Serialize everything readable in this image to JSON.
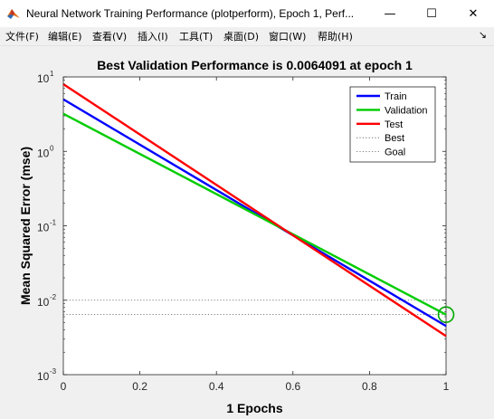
{
  "window": {
    "title": "Neural Network Training Performance (plotperform), Epoch 1, Perf...",
    "app_icon": "matlab-icon",
    "minimize_glyph": "—",
    "maximize_glyph": "☐",
    "close_glyph": "✕"
  },
  "menubar": {
    "items": [
      {
        "label": "文件(F)"
      },
      {
        "label": "编辑(E)"
      },
      {
        "label": "查看(V)"
      },
      {
        "label": "插入(I)"
      },
      {
        "label": "工具(T)"
      },
      {
        "label": "桌面(D)"
      },
      {
        "label": "窗口(W)"
      },
      {
        "label": "帮助(H)"
      }
    ],
    "overflow_glyph": "↘"
  },
  "chart_data": {
    "type": "line",
    "title": "Best Validation Performance is 0.0064091 at epoch 1",
    "xlabel": "1 Epochs",
    "ylabel": "Mean Squared Error  (mse)",
    "xlim": [
      0,
      1
    ],
    "ylim": [
      0.001,
      10
    ],
    "yscale": "log",
    "xticks": [
      "0",
      "0.2",
      "0.4",
      "0.6",
      "0.8",
      "1"
    ],
    "yticks": [
      {
        "base": "10",
        "exp": "1",
        "value": 10
      },
      {
        "base": "10",
        "exp": "0",
        "value": 1
      },
      {
        "base": "10",
        "exp": "-1",
        "value": 0.1
      },
      {
        "base": "10",
        "exp": "-2",
        "value": 0.01
      },
      {
        "base": "10",
        "exp": "-3",
        "value": 0.001
      }
    ],
    "grid": false,
    "legend_position": "top-right",
    "series": [
      {
        "name": "Train",
        "x": [
          0,
          1
        ],
        "y": [
          5.0,
          0.0045
        ],
        "color": "#0000ff",
        "style": "solid"
      },
      {
        "name": "Validation",
        "x": [
          0,
          1
        ],
        "y": [
          3.2,
          0.0064091
        ],
        "color": "#00cc00",
        "style": "solid"
      },
      {
        "name": "Test",
        "x": [
          0,
          1
        ],
        "y": [
          8.0,
          0.0033
        ],
        "color": "#ff0000",
        "style": "solid"
      }
    ],
    "reference_lines": [
      {
        "name": "Best",
        "y": 0.0064091,
        "color": "#555555",
        "style": "dotted"
      },
      {
        "name": "Goal",
        "y": 0.01,
        "color": "#555555",
        "style": "dotted"
      }
    ],
    "best_marker": {
      "x": 1,
      "y": 0.0064091,
      "color": "#00aa00",
      "shape": "circle"
    }
  }
}
